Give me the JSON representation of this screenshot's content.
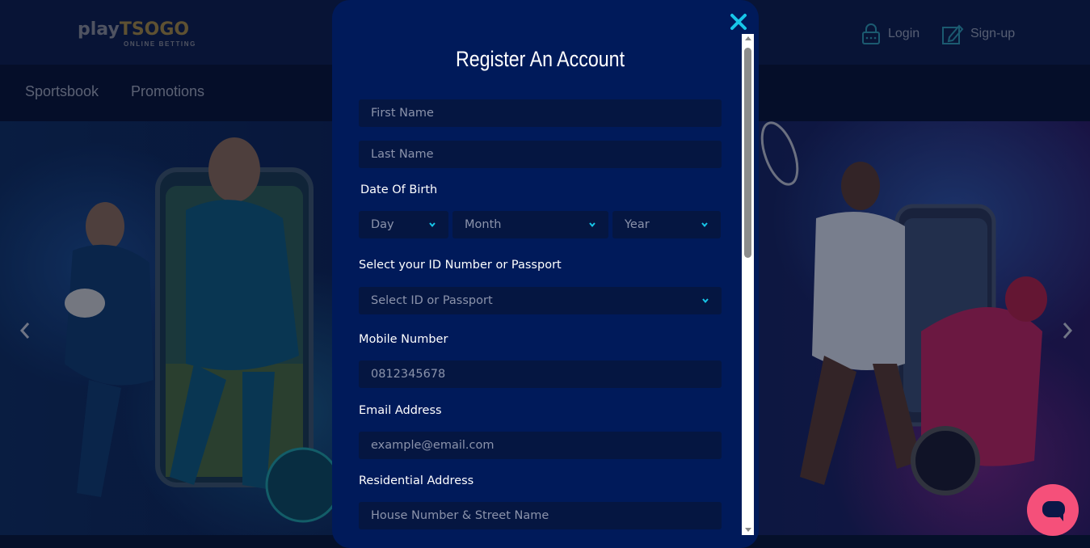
{
  "header": {
    "logo_play": "play",
    "logo_tsogo": "TSOGO",
    "logo_sub": "ONLINE BETTING",
    "login_label": "Login",
    "signup_label": "Sign-up"
  },
  "nav": {
    "items": [
      {
        "label": "Sportsbook"
      },
      {
        "label": "Promotions"
      }
    ]
  },
  "modal": {
    "title": "Register An Account",
    "first_name_placeholder": "First Name",
    "last_name_placeholder": "Last Name",
    "dob_label": "Date Of Birth",
    "dob_day": "Day",
    "dob_month": "Month",
    "dob_year": "Year",
    "id_label": "Select your ID Number or Passport",
    "id_select": "Select ID or Passport",
    "mobile_label": "Mobile Number",
    "mobile_placeholder": "0812345678",
    "email_label": "Email Address",
    "email_placeholder": "example@email.com",
    "address_label": "Residential Address",
    "address_placeholder": "House Number & Street Name"
  },
  "colors": {
    "modal_bg": "#001a5a",
    "field_bg": "#051641",
    "close_accent": "#17c6e8",
    "chat_button": "#f5507a",
    "logo_gold": "#a88a3f"
  },
  "icons": {
    "close": "close-icon",
    "login": "lock-icon",
    "signup": "edit-icon",
    "prev": "chevron-left-icon",
    "next": "chevron-right-icon",
    "chat": "chat-icon"
  }
}
